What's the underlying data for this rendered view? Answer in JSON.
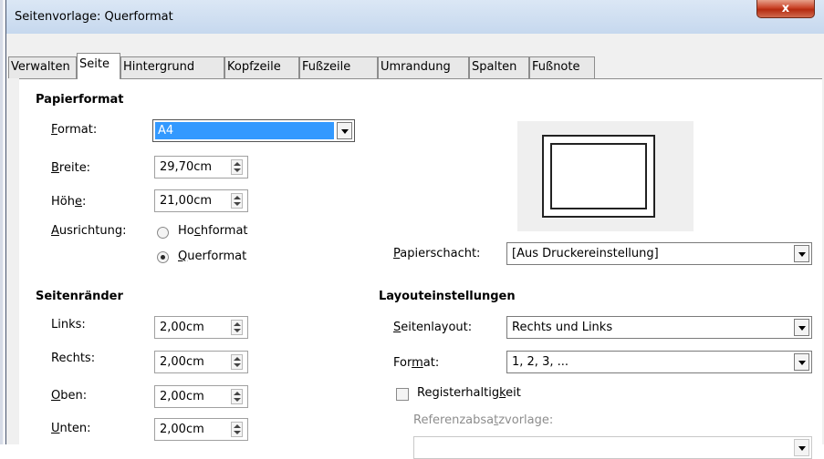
{
  "window": {
    "title": "Seitenvorlage: Querformat",
    "close_label": "x"
  },
  "tabs": [
    {
      "label": "Verwalten",
      "active": false
    },
    {
      "label": "Seite",
      "active": true
    },
    {
      "label": "Hintergrund",
      "active": false
    },
    {
      "label": "Kopfzeile",
      "active": false
    },
    {
      "label": "Fußzeile",
      "active": false
    },
    {
      "label": "Umrandung",
      "active": false
    },
    {
      "label": "Spalten",
      "active": false
    },
    {
      "label": "Fußnote",
      "active": false
    }
  ],
  "paper": {
    "heading": "Papierformat",
    "format_label": "Format:",
    "format_value": "A4",
    "width_label": "Breite:",
    "width_value": "29,70cm",
    "height_label": "Höhe:",
    "height_value": "21,00cm",
    "orientation_label": "Ausrichtung:",
    "portrait_label": "Hochformat",
    "landscape_label": "Querformat",
    "orientation_selected": "Querformat",
    "tray_label": "Papierschacht:",
    "tray_value": "[Aus Druckereinstellung]"
  },
  "margins": {
    "heading": "Seitenränder",
    "left_label": "Links:",
    "left_value": "2,00cm",
    "right_label": "Rechts:",
    "right_value": "2,00cm",
    "top_label": "Oben:",
    "top_value": "2,00cm",
    "bottom_label": "Unten:",
    "bottom_value": "2,00cm"
  },
  "layout": {
    "heading": "Layouteinstellungen",
    "page_layout_label": "Seitenlayout:",
    "page_layout_value": "Rechts und Links",
    "format_label": "Format:",
    "format_value": "1, 2, 3, ...",
    "register_label": "Registerhaltigkeit",
    "register_checked": false,
    "reference_label": "Referenzabsatzvorlage:",
    "reference_value": ""
  },
  "colors": {
    "selection": "#3399ff",
    "disabled_text": "#8d8d8d"
  }
}
